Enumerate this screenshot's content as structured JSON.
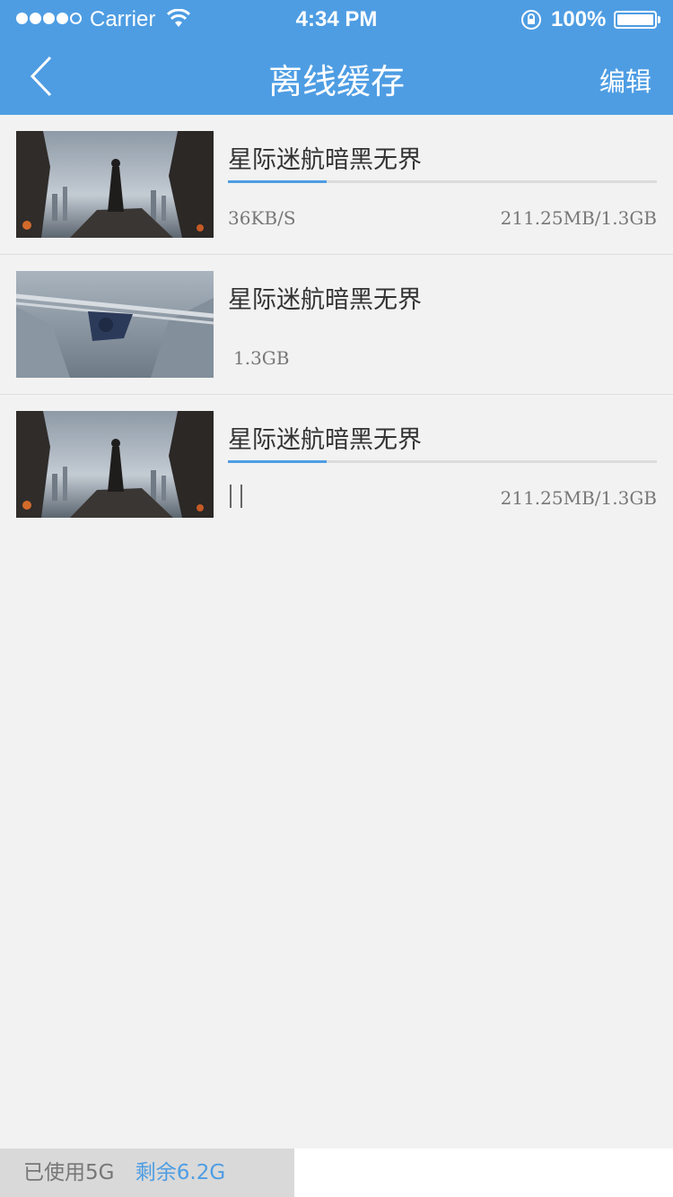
{
  "status": {
    "carrier": "Carrier",
    "time": "4:34 PM",
    "battery": "100%"
  },
  "nav": {
    "title": "离线缓存",
    "edit_label": "编辑"
  },
  "items": [
    {
      "title": "星际迷航暗黑无界",
      "speed": "36KB/S",
      "progress_text": "211.25MB/1.3GB",
      "progress": 0.23,
      "state": "downloading"
    },
    {
      "title": "星际迷航暗黑无界",
      "size": "1.3GB",
      "state": "completed"
    },
    {
      "title": "星际迷航暗黑无界",
      "progress_text": "211.25MB/1.3GB",
      "progress": 0.23,
      "state": "paused"
    }
  ],
  "storage": {
    "used": "已使用5G",
    "remaining": "剩余6.2G"
  },
  "colors": {
    "accent": "#4e9de3"
  }
}
